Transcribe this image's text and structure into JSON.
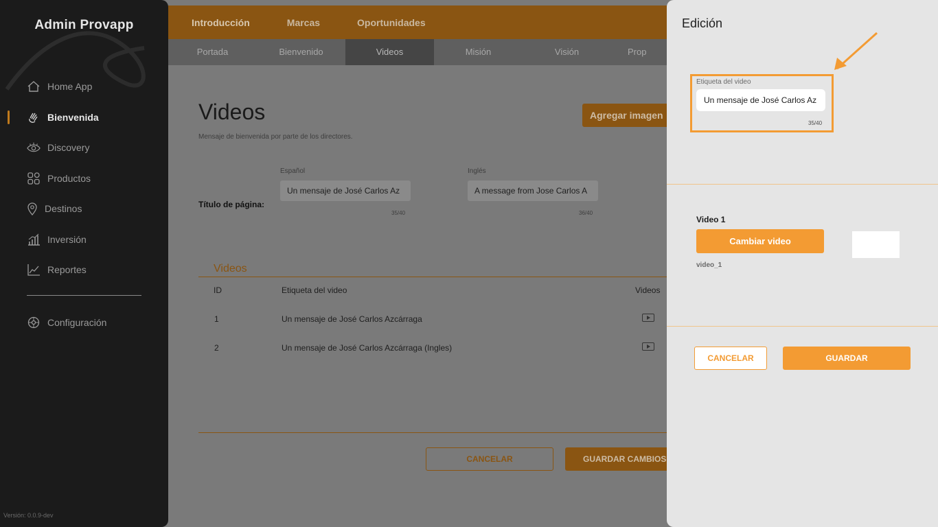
{
  "sidebar": {
    "brand": "Admin Provapp",
    "items": [
      {
        "label": "Home App",
        "icon": "home-icon"
      },
      {
        "label": "Bienvenida",
        "icon": "waving-hand-icon",
        "active": true
      },
      {
        "label": "Discovery",
        "icon": "eye-icon"
      },
      {
        "label": "Productos",
        "icon": "grid-icon"
      },
      {
        "label": "Destinos",
        "icon": "map-pin-icon"
      },
      {
        "label": "Inversión",
        "icon": "bar-chart-icon"
      },
      {
        "label": "Reportes",
        "icon": "line-chart-icon"
      }
    ],
    "config": {
      "label": "Configuración",
      "icon": "gear-icon"
    },
    "version": "Versión: 0.0.9-dev"
  },
  "topbar": {
    "tabs": [
      "Introducción",
      "Marcas",
      "Oportunidades"
    ]
  },
  "subbar": {
    "tabs": [
      "Portada",
      "Bienvenido",
      "Videos",
      "Misión",
      "Visión",
      "Prop"
    ]
  },
  "main": {
    "title": "Videos",
    "subtitle": "Mensaje de bienvenida por parte de los directores.",
    "add_button": "Agregar imagen",
    "row_label": "Título de página:",
    "spanish": {
      "label": "Español",
      "value": "Un mensaje de José Carlos Az",
      "count": "35/40"
    },
    "english": {
      "label": "Inglés",
      "value": "A message from Jose Carlos A",
      "count": "36/40"
    },
    "section_title": "Videos",
    "table": {
      "headers": [
        "ID",
        "Etiqueta del video",
        "Videos"
      ],
      "rows": [
        {
          "id": "1",
          "label": "Un mensaje de José Carlos Azcárraga"
        },
        {
          "id": "2",
          "label": "Un mensaje de José Carlos Azcárraga (Ingles)"
        }
      ]
    },
    "cancel": "CANCELAR",
    "save": "GUARDAR CAMBIOS"
  },
  "panel": {
    "title": "Edición",
    "field_label": "Etiqueta del video",
    "field_value": "Un mensaje de José Carlos Az",
    "field_count": "35/40",
    "video_label": "Video 1",
    "change_button": "Cambiar video",
    "video_file": "video_1",
    "cancel": "CANCELAR",
    "save": "GUARDAR"
  },
  "colors": {
    "accent": "#f39b33",
    "sidebar_bg": "#1b1b1b",
    "panel_bg": "#e5e5e5"
  }
}
